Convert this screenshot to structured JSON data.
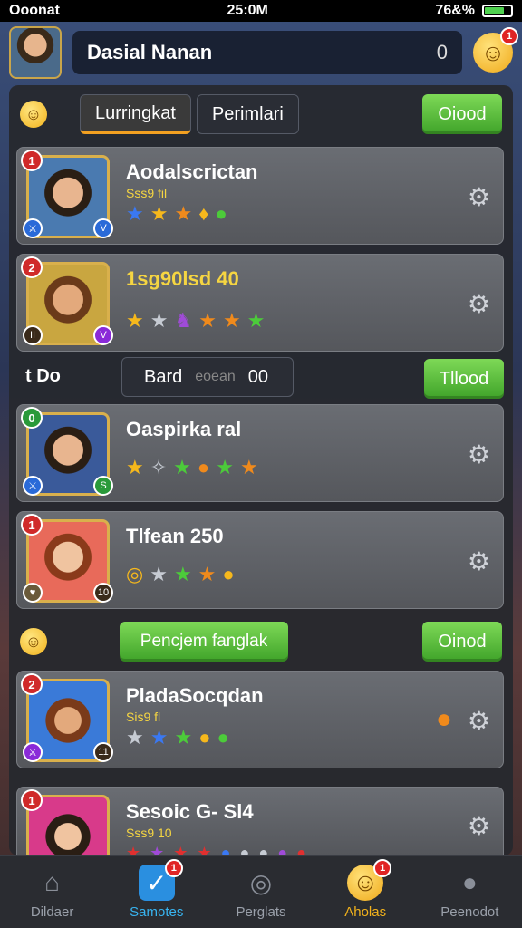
{
  "status": {
    "carrier": "Ooonat",
    "time": "25:0M",
    "battery": "76&%",
    "battery_level": 0.7
  },
  "header": {
    "player_name": "Dasial Nanan",
    "count": "0",
    "badge": "1"
  },
  "tabs": [
    {
      "label": "Lurringkat"
    },
    {
      "label": "Perimlari"
    }
  ],
  "top_button": "Oiood",
  "cards": [
    {
      "title": "Aodalscrictan",
      "sub": "Sss9 fil",
      "level": "1",
      "icons": [
        "★",
        "★",
        "★",
        "♦",
        "●"
      ]
    },
    {
      "title": "1sg90lsd 40",
      "sub": "",
      "level": "2",
      "icons": [
        "★",
        "★",
        "♞",
        "★",
        "★",
        "★"
      ]
    },
    {
      "title": "Oaspirka ral",
      "sub": "",
      "level": "0",
      "icons": [
        "★",
        "✧",
        "★",
        "●",
        "★",
        "★"
      ]
    },
    {
      "title": "Tlfean 250",
      "sub": "",
      "level": "1",
      "icons": [
        "◎",
        "★",
        "★",
        "★",
        "●"
      ]
    },
    {
      "title": "PladaSocqdan",
      "sub": "Sis9 fl",
      "level": "2",
      "icons": [
        "★",
        "★",
        "★",
        "●",
        "●"
      ]
    },
    {
      "title": "Sesoic G- Sl4",
      "sub": "Sss9 10",
      "level": "1",
      "icons": [
        "★",
        "★",
        "★",
        "★",
        "●",
        "●",
        "●",
        "●",
        "●"
      ]
    }
  ],
  "mid_row": {
    "left": "t Do",
    "label": "Bard",
    "muted": "eoean",
    "value": "00",
    "button": "Tllood"
  },
  "bottom_row": {
    "button_center": "Pencjem fanglak",
    "button_right": "Oinod"
  },
  "nav": [
    {
      "label": "Dildaer",
      "icon": "home-icon"
    },
    {
      "label": "Samotes",
      "icon": "check-icon",
      "badge": "1"
    },
    {
      "label": "Perglats",
      "icon": "circle-icon"
    },
    {
      "label": "Aholas",
      "icon": "smile-icon",
      "badge": "1"
    },
    {
      "label": "Peenodot",
      "icon": "person-icon"
    }
  ]
}
